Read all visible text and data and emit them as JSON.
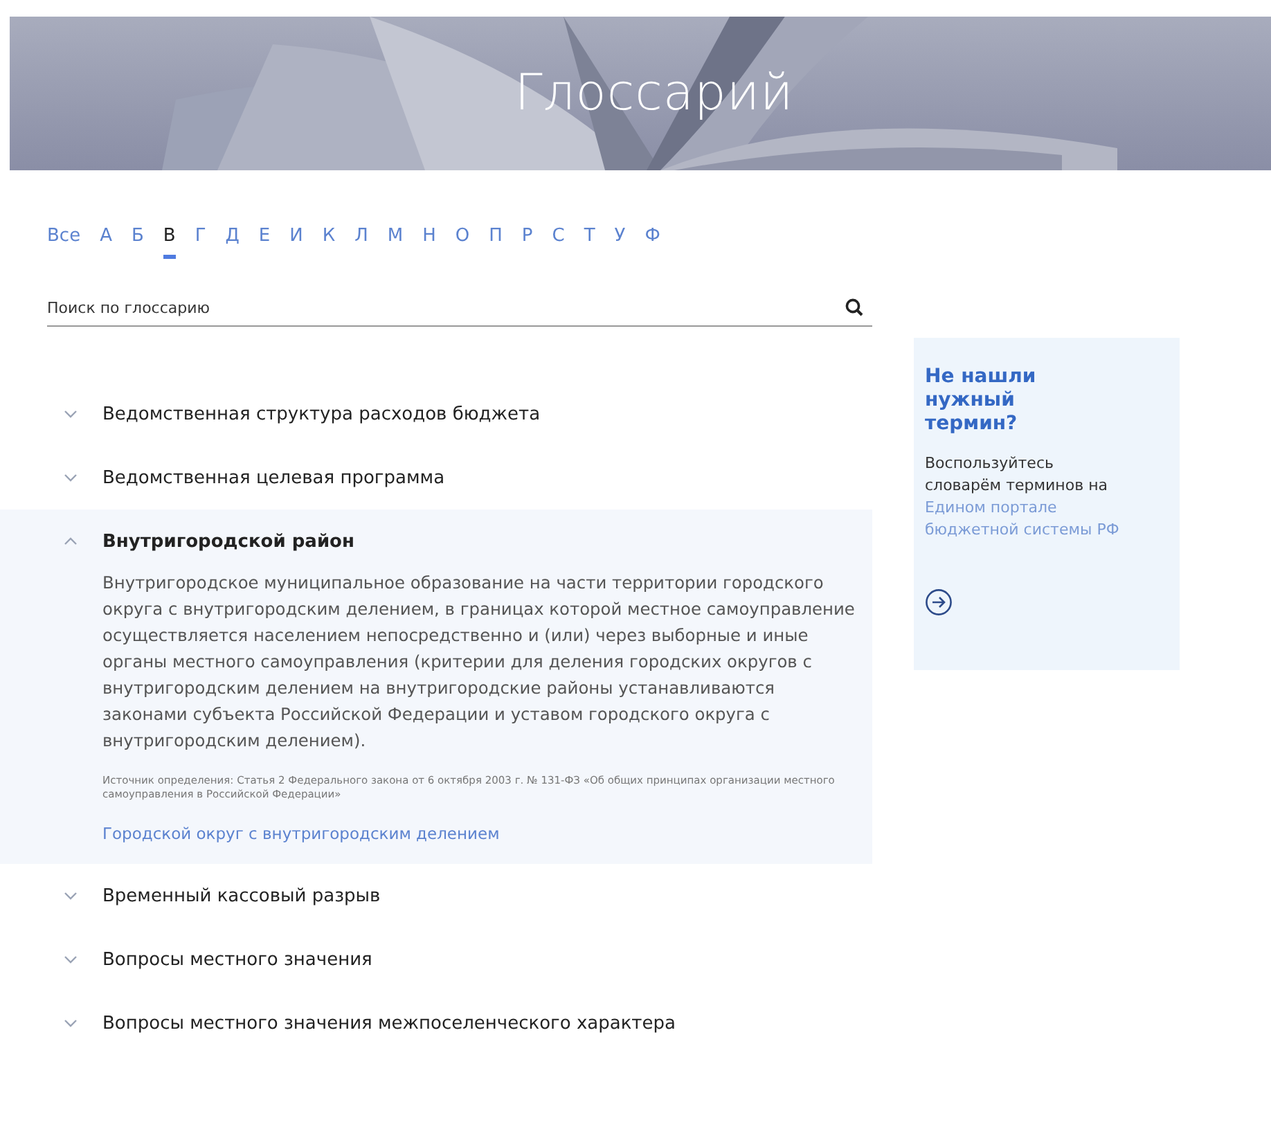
{
  "header": {
    "title": "Глоссарий"
  },
  "alphabet": [
    {
      "label": "Все",
      "selected": false
    },
    {
      "label": "А",
      "selected": false
    },
    {
      "label": "Б",
      "selected": false
    },
    {
      "label": "В",
      "selected": true
    },
    {
      "label": "Г",
      "selected": false
    },
    {
      "label": "Д",
      "selected": false
    },
    {
      "label": "Е",
      "selected": false
    },
    {
      "label": "И",
      "selected": false
    },
    {
      "label": "К",
      "selected": false
    },
    {
      "label": "Л",
      "selected": false
    },
    {
      "label": "М",
      "selected": false
    },
    {
      "label": "Н",
      "selected": false
    },
    {
      "label": "О",
      "selected": false
    },
    {
      "label": "П",
      "selected": false
    },
    {
      "label": "Р",
      "selected": false
    },
    {
      "label": "С",
      "selected": false
    },
    {
      "label": "Т",
      "selected": false
    },
    {
      "label": "У",
      "selected": false
    },
    {
      "label": "Ф",
      "selected": false
    }
  ],
  "search": {
    "placeholder": "Поиск по глоссарию"
  },
  "terms": [
    {
      "title": "Ведомственная структура расходов бюджета",
      "expanded": false
    },
    {
      "title": "Ведомственная целевая программа",
      "expanded": false
    },
    {
      "title": "Внутригородской район",
      "expanded": true,
      "definition": "Внутригородское муниципальное образование на части территории городского округа с внутригородским делением, в границах которой местное самоуправление осуществляется населением непосредственно и (или) через выборные и иные органы местного самоуправления (критерии для деления городских округов с внутригородским делением на внутригородские районы устанавливаются законами субъекта Российской Федерации и уставом городского округа с внутригородским делением).",
      "source": "Источник определения: Статья 2 Федерального закона от 6 октября 2003 г. № 131-ФЗ «Об общих принципах организации местного самоуправления в Российской Федерации»",
      "related": "Городской округ с внутригородским делением"
    },
    {
      "title": "Временный кассовый разрыв",
      "expanded": false
    },
    {
      "title": "Вопросы местного значения",
      "expanded": false
    },
    {
      "title": "Вопросы местного значения межпоселенческого характера",
      "expanded": false
    }
  ],
  "aside": {
    "title": "Не нашли нужный термин?",
    "text": "Воспользуйтесь словарём терминов на",
    "link": "Едином портале бюджетной системы РФ"
  }
}
